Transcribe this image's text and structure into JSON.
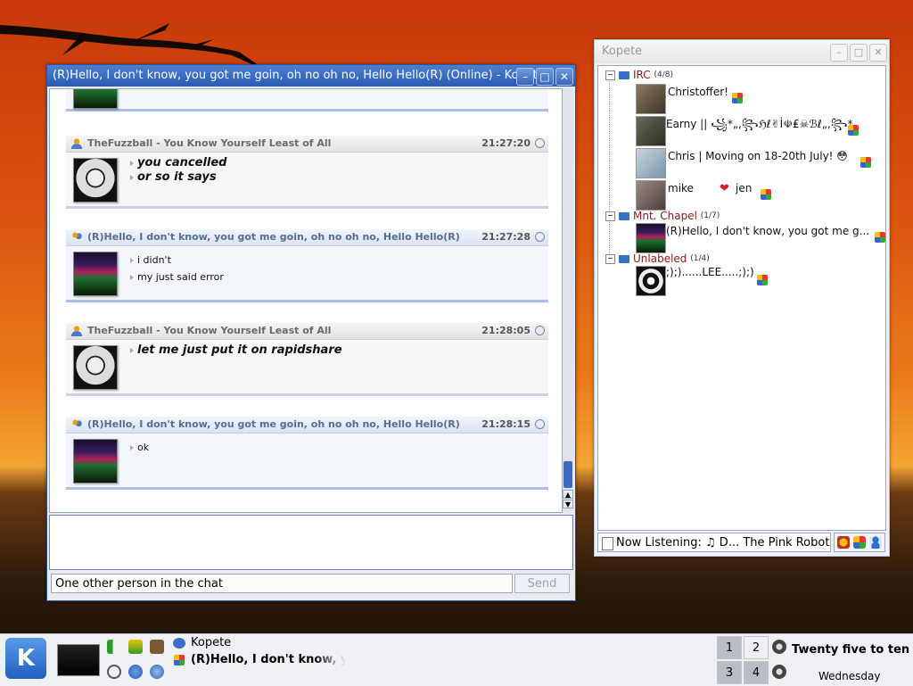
{
  "chat": {
    "title": "(R)Hello, I don't know, you got me goin, oh no oh no, Hello Hello(R) (Online) - Kopete",
    "messages": [
      {
        "sender": "TheFuzzball - You Know Yourself Least of All",
        "time": "21:27:20",
        "lines": [
          "you cancelled",
          "or so it says"
        ],
        "self": false
      },
      {
        "sender": "(R)Hello, I don't know, you got me goin, oh no oh no, Hello Hello(R)",
        "time": "21:27:28",
        "lines": [
          "i didn't",
          "my just said error"
        ],
        "self": true
      },
      {
        "sender": "TheFuzzball - You Know Yourself Least of All",
        "time": "21:28:05",
        "lines": [
          "let me just put it on rapidshare"
        ],
        "self": false
      },
      {
        "sender": "(R)Hello, I don't know, you got me goin, oh no oh no, Hello Hello(R)",
        "time": "21:28:15",
        "lines": [
          "ok"
        ],
        "self": true
      }
    ],
    "status_text": "One other person in the chat",
    "send_label": "Send"
  },
  "kopete": {
    "title": "Kopete",
    "groups": [
      {
        "name": "IRC",
        "count": "(4/8)"
      },
      {
        "name": "Mnt. Chapel",
        "count": "(1/7)"
      },
      {
        "name": "Unlabeled",
        "count": "(1/4)"
      }
    ],
    "contacts": [
      {
        "name": "Christoffer!"
      },
      {
        "name": "Earny || ꧁*„,꧂ℌℓ✌İ☫₤☠ℬℓ„,꧂*"
      },
      {
        "name": "Chris | Moving on 18-20th July! 😳"
      },
      {
        "name": "mike",
        "name2": "jen"
      },
      {
        "name": "(R)Hello, I don't know, you got me g..."
      },
      {
        "name": ";);)......LEE.....;);)"
      }
    ],
    "now_listening": "Now Listening: ♫ D... The Pink Robot) ♫"
  },
  "taskbar": {
    "task1": "Kopete",
    "task2": "(R)Hello, I don't know, yo",
    "desktops": [
      "1",
      "2",
      "3",
      "4"
    ],
    "time": "Twenty five to ten",
    "day": "Wednesday"
  }
}
